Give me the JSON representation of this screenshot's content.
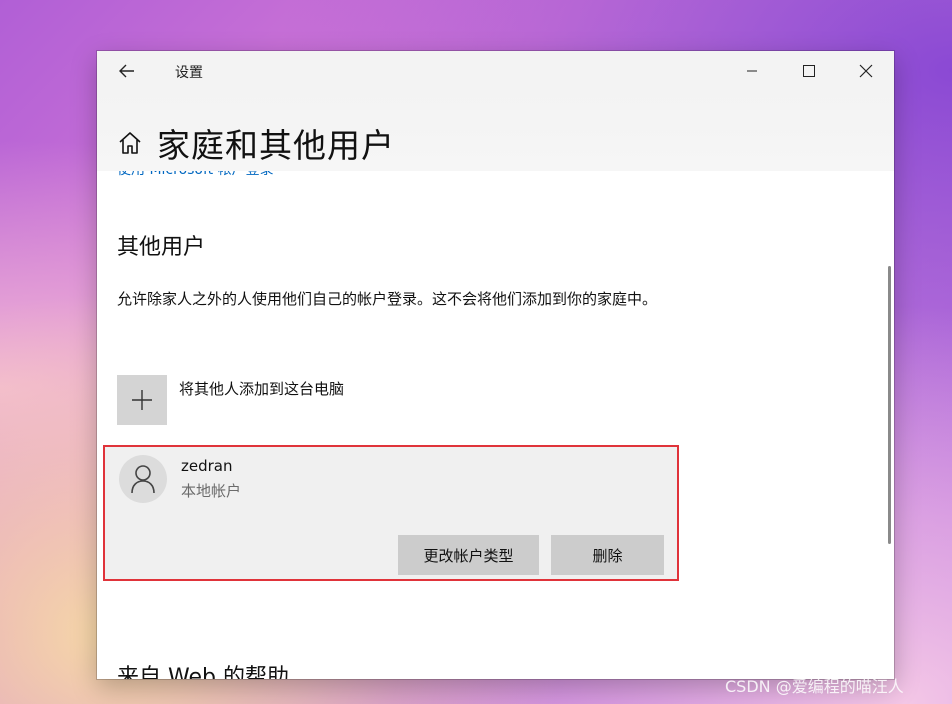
{
  "window": {
    "app_title": "设置",
    "page_title": "家庭和其他用户",
    "peek_link": "使用 Microsoft 帐户登录"
  },
  "icons": {
    "back": "arrow-left-icon",
    "minimize": "minimize-icon",
    "maximize": "maximize-icon",
    "close": "close-icon",
    "home": "home-icon",
    "add": "plus-icon",
    "user": "person-icon"
  },
  "other_users": {
    "title": "其他用户",
    "description": "允许除家人之外的人使用他们自己的帐户登录。这不会将他们添加到你的家庭中。",
    "add_label": "将其他人添加到这台电脑",
    "user": {
      "name": "zedran",
      "type": "本地帐户",
      "change_type_button": "更改帐户类型",
      "delete_button": "删除"
    }
  },
  "help_section": {
    "title": "来自 Web 的帮助"
  },
  "watermark": "CSDN @爱编程的喵汪人",
  "colors": {
    "highlight_border": "#e0333a",
    "button_bg": "#cccccc",
    "card_bg": "#f0f0f0",
    "link": "#0067c0"
  }
}
